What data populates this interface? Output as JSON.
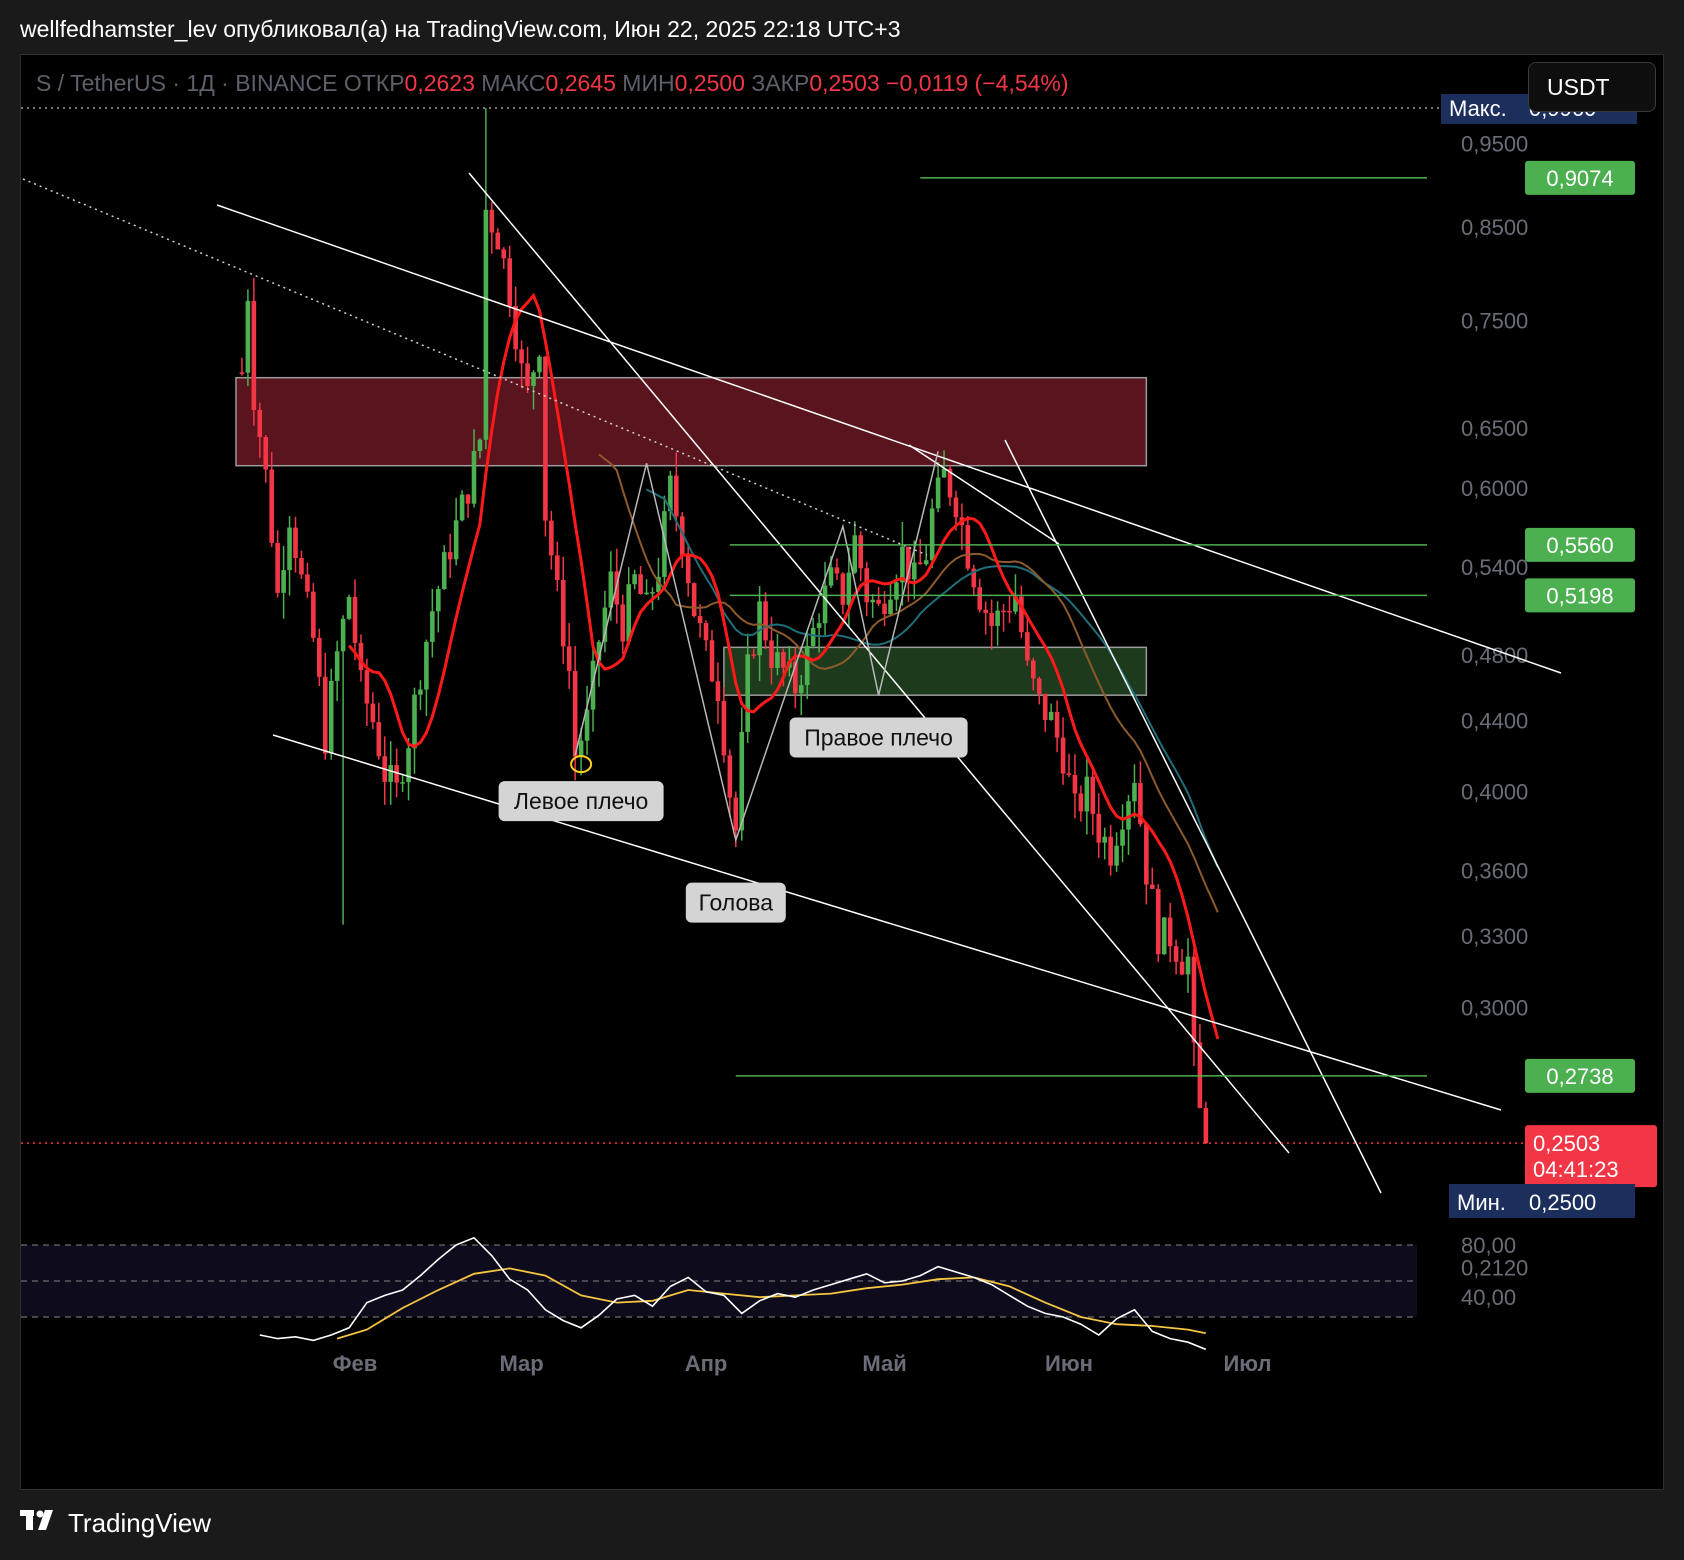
{
  "header": {
    "published_line": "wellfedhamster_lev опубликовал(а) на TradingView.com, Июн 22, 2025 22:18 UTC+3"
  },
  "symbol_bar": {
    "symbol": "S / TetherUS · 1Д · BINANCE",
    "open_label": "ОТКР",
    "open": "0,2623",
    "high_label": "МАКС",
    "high": "0,2645",
    "low_label": "МИН",
    "low": "0,2500",
    "close_label": "ЗАКР",
    "close": "0,2503",
    "change": "−0,0119 (−4,54%)"
  },
  "currency_button": "USDT",
  "footer": {
    "brand": "TradingView"
  },
  "colors": {
    "bull": "#4caf50",
    "bear": "#f23645",
    "ma_red": "#ff1a1a",
    "ma_brown": "#8d5a2b",
    "ma_teal": "#1e6f7a",
    "level_green": "#4caf50",
    "resistance_zone": "#5a141e",
    "support_zone": "#1d3a1c",
    "rsi": "#ffffff",
    "rsi_ma": "#f5c542",
    "marker_navy": "#1c2e5c"
  },
  "chart_data": {
    "type": "candlestick",
    "symbol": "S / TetherUS",
    "interval": "1Д",
    "exchange": "BINANCE",
    "y_scale": "log",
    "ylim": [
      0.205,
      1.0
    ],
    "y_ticks": [
      {
        "v": 0.95,
        "label": "0,9500"
      },
      {
        "v": 0.85,
        "label": "0,8500"
      },
      {
        "v": 0.75,
        "label": "0,7500"
      },
      {
        "v": 0.65,
        "label": "0,6500"
      },
      {
        "v": 0.6,
        "label": "0,6000"
      },
      {
        "v": 0.54,
        "label": "0,5400"
      },
      {
        "v": 0.48,
        "label": "0,4800"
      },
      {
        "v": 0.44,
        "label": "0,4400"
      },
      {
        "v": 0.4,
        "label": "0,4000"
      },
      {
        "v": 0.36,
        "label": "0,3600"
      },
      {
        "v": 0.33,
        "label": "0,3300"
      },
      {
        "v": 0.3,
        "label": "0,3000"
      },
      {
        "v": 0.212,
        "label": "0,2120"
      }
    ],
    "x_labels": [
      "Фев",
      "Мар",
      "Апр",
      "Май",
      "Июн",
      "Июл"
    ],
    "x_label_days": [
      31,
      59,
      90,
      120,
      151,
      181
    ],
    "ohlc_anchors": [
      {
        "d": 12,
        "c": 0.7
      },
      {
        "d": 13,
        "c": 0.78
      },
      {
        "d": 14,
        "c": 0.68
      },
      {
        "d": 16,
        "c": 0.61
      },
      {
        "d": 18,
        "c": 0.52
      },
      {
        "d": 20,
        "c": 0.58
      },
      {
        "d": 22,
        "c": 0.53
      },
      {
        "d": 24,
        "c": 0.49
      },
      {
        "d": 26,
        "c": 0.43
      },
      {
        "d": 28,
        "c": 0.48
      },
      {
        "d": 30,
        "c": 0.52
      },
      {
        "d": 32,
        "c": 0.46
      },
      {
        "d": 34,
        "c": 0.44
      },
      {
        "d": 36,
        "c": 0.41
      },
      {
        "d": 38,
        "c": 0.4
      },
      {
        "d": 40,
        "c": 0.43
      },
      {
        "d": 42,
        "c": 0.47
      },
      {
        "d": 44,
        "c": 0.51
      },
      {
        "d": 46,
        "c": 0.54
      },
      {
        "d": 48,
        "c": 0.57
      },
      {
        "d": 50,
        "c": 0.6
      },
      {
        "d": 52,
        "c": 0.64
      },
      {
        "d": 53,
        "c": 0.87
      },
      {
        "d": 55,
        "c": 0.84
      },
      {
        "d": 57,
        "c": 0.78
      },
      {
        "d": 59,
        "c": 0.7
      },
      {
        "d": 60,
        "c": 0.68
      },
      {
        "d": 62,
        "c": 0.73
      },
      {
        "d": 63,
        "c": 0.58
      },
      {
        "d": 65,
        "c": 0.52
      },
      {
        "d": 67,
        "c": 0.47
      },
      {
        "d": 68,
        "c": 0.42
      },
      {
        "d": 70,
        "c": 0.44
      },
      {
        "d": 72,
        "c": 0.49
      },
      {
        "d": 74,
        "c": 0.53
      },
      {
        "d": 76,
        "c": 0.5
      },
      {
        "d": 78,
        "c": 0.53
      },
      {
        "d": 80,
        "c": 0.51
      },
      {
        "d": 82,
        "c": 0.54
      },
      {
        "d": 84,
        "c": 0.6
      },
      {
        "d": 86,
        "c": 0.56
      },
      {
        "d": 88,
        "c": 0.51
      },
      {
        "d": 90,
        "c": 0.48
      },
      {
        "d": 92,
        "c": 0.46
      },
      {
        "d": 94,
        "c": 0.4
      },
      {
        "d": 95,
        "c": 0.38
      },
      {
        "d": 97,
        "c": 0.47
      },
      {
        "d": 99,
        "c": 0.51
      },
      {
        "d": 101,
        "c": 0.48
      },
      {
        "d": 103,
        "c": 0.47
      },
      {
        "d": 105,
        "c": 0.46
      },
      {
        "d": 107,
        "c": 0.48
      },
      {
        "d": 109,
        "c": 0.51
      },
      {
        "d": 111,
        "c": 0.53
      },
      {
        "d": 113,
        "c": 0.52
      },
      {
        "d": 115,
        "c": 0.56
      },
      {
        "d": 117,
        "c": 0.52
      },
      {
        "d": 119,
        "c": 0.51
      },
      {
        "d": 121,
        "c": 0.53
      },
      {
        "d": 123,
        "c": 0.55
      },
      {
        "d": 125,
        "c": 0.53
      },
      {
        "d": 127,
        "c": 0.55
      },
      {
        "d": 128,
        "c": 0.58
      },
      {
        "d": 130,
        "c": 0.61
      },
      {
        "d": 132,
        "c": 0.59
      },
      {
        "d": 134,
        "c": 0.55
      },
      {
        "d": 136,
        "c": 0.52
      },
      {
        "d": 138,
        "c": 0.5
      },
      {
        "d": 140,
        "c": 0.51
      },
      {
        "d": 142,
        "c": 0.52
      },
      {
        "d": 144,
        "c": 0.47
      },
      {
        "d": 146,
        "c": 0.45
      },
      {
        "d": 148,
        "c": 0.44
      },
      {
        "d": 150,
        "c": 0.42
      },
      {
        "d": 152,
        "c": 0.39
      },
      {
        "d": 154,
        "c": 0.4
      },
      {
        "d": 156,
        "c": 0.38
      },
      {
        "d": 158,
        "c": 0.37
      },
      {
        "d": 160,
        "c": 0.39
      },
      {
        "d": 162,
        "c": 0.41
      },
      {
        "d": 164,
        "c": 0.36
      },
      {
        "d": 166,
        "c": 0.33
      },
      {
        "d": 168,
        "c": 0.33
      },
      {
        "d": 170,
        "c": 0.32
      },
      {
        "d": 171,
        "c": 0.32
      },
      {
        "d": 172,
        "c": 0.28
      },
      {
        "d": 173,
        "c": 0.2623
      },
      {
        "d": 174,
        "c": 0.2503
      }
    ],
    "zones": [
      {
        "name": "resistance",
        "d0": 11,
        "d1": 164,
        "low": 0.618,
        "high": 0.695
      },
      {
        "name": "support",
        "d0": 93,
        "d1": 164,
        "low": 0.455,
        "high": 0.485
      }
    ],
    "horizontal_levels": [
      {
        "value": 0.9074,
        "label": "0,9074",
        "d0": 126
      },
      {
        "value": 0.556,
        "label": "0,5560",
        "d0": 94
      },
      {
        "value": 0.5198,
        "label": "0,5198",
        "d0": 94
      },
      {
        "value": 0.2738,
        "label": "0,2738",
        "d0": 95
      }
    ],
    "price_markers": [
      {
        "type": "max",
        "label": "Макс.",
        "value": 0.996,
        "value_label": "0,9960"
      },
      {
        "type": "current",
        "value": 0.2503,
        "value_label": "0,2503",
        "countdown": "04:41:23"
      },
      {
        "type": "min",
        "label": "Мин.",
        "value": 0.25,
        "value_label": "0,2500"
      }
    ],
    "pattern_labels": [
      {
        "text": "Левое плечо",
        "d": 69,
        "v": 0.395
      },
      {
        "text": "Голова",
        "d": 95,
        "v": 0.345
      },
      {
        "text": "Правое плечо",
        "d": 119,
        "v": 0.43
      }
    ],
    "rsi": {
      "levels": [
        80,
        60,
        40
      ],
      "tick_labels": [
        "80,00",
        "40,00"
      ],
      "values": [
        {
          "d": 15,
          "v": 30
        },
        {
          "d": 18,
          "v": 28
        },
        {
          "d": 21,
          "v": 29
        },
        {
          "d": 24,
          "v": 27
        },
        {
          "d": 27,
          "v": 30
        },
        {
          "d": 30,
          "v": 34
        },
        {
          "d": 33,
          "v": 48
        },
        {
          "d": 36,
          "v": 52
        },
        {
          "d": 39,
          "v": 55
        },
        {
          "d": 42,
          "v": 63
        },
        {
          "d": 45,
          "v": 72
        },
        {
          "d": 48,
          "v": 80
        },
        {
          "d": 51,
          "v": 84
        },
        {
          "d": 54,
          "v": 74
        },
        {
          "d": 57,
          "v": 61
        },
        {
          "d": 60,
          "v": 55
        },
        {
          "d": 63,
          "v": 44
        },
        {
          "d": 66,
          "v": 38
        },
        {
          "d": 69,
          "v": 34
        },
        {
          "d": 72,
          "v": 41
        },
        {
          "d": 75,
          "v": 50
        },
        {
          "d": 78,
          "v": 52
        },
        {
          "d": 81,
          "v": 46
        },
        {
          "d": 84,
          "v": 57
        },
        {
          "d": 87,
          "v": 62
        },
        {
          "d": 90,
          "v": 54
        },
        {
          "d": 93,
          "v": 52
        },
        {
          "d": 96,
          "v": 42
        },
        {
          "d": 99,
          "v": 49
        },
        {
          "d": 102,
          "v": 53
        },
        {
          "d": 105,
          "v": 51
        },
        {
          "d": 108,
          "v": 55
        },
        {
          "d": 111,
          "v": 58
        },
        {
          "d": 114,
          "v": 61
        },
        {
          "d": 117,
          "v": 64
        },
        {
          "d": 120,
          "v": 59
        },
        {
          "d": 123,
          "v": 60
        },
        {
          "d": 126,
          "v": 63
        },
        {
          "d": 129,
          "v": 68
        },
        {
          "d": 132,
          "v": 65
        },
        {
          "d": 135,
          "v": 62
        },
        {
          "d": 138,
          "v": 58
        },
        {
          "d": 141,
          "v": 52
        },
        {
          "d": 144,
          "v": 46
        },
        {
          "d": 147,
          "v": 42
        },
        {
          "d": 150,
          "v": 40
        },
        {
          "d": 153,
          "v": 36
        },
        {
          "d": 156,
          "v": 30
        },
        {
          "d": 159,
          "v": 39
        },
        {
          "d": 162,
          "v": 44
        },
        {
          "d": 165,
          "v": 32
        },
        {
          "d": 168,
          "v": 28
        },
        {
          "d": 171,
          "v": 26
        },
        {
          "d": 174,
          "v": 22
        }
      ],
      "ma_values": [
        {
          "d": 28,
          "v": 28
        },
        {
          "d": 33,
          "v": 33
        },
        {
          "d": 39,
          "v": 45
        },
        {
          "d": 45,
          "v": 55
        },
        {
          "d": 51,
          "v": 64
        },
        {
          "d": 57,
          "v": 67
        },
        {
          "d": 63,
          "v": 63
        },
        {
          "d": 69,
          "v": 52
        },
        {
          "d": 75,
          "v": 48
        },
        {
          "d": 81,
          "v": 49
        },
        {
          "d": 87,
          "v": 55
        },
        {
          "d": 93,
          "v": 53
        },
        {
          "d": 99,
          "v": 51
        },
        {
          "d": 105,
          "v": 52
        },
        {
          "d": 111,
          "v": 53
        },
        {
          "d": 117,
          "v": 56
        },
        {
          "d": 123,
          "v": 58
        },
        {
          "d": 129,
          "v": 61
        },
        {
          "d": 135,
          "v": 62
        },
        {
          "d": 141,
          "v": 57
        },
        {
          "d": 147,
          "v": 48
        },
        {
          "d": 153,
          "v": 40
        },
        {
          "d": 159,
          "v": 36
        },
        {
          "d": 165,
          "v": 35
        },
        {
          "d": 171,
          "v": 33
        },
        {
          "d": 174,
          "v": 31
        }
      ]
    }
  }
}
